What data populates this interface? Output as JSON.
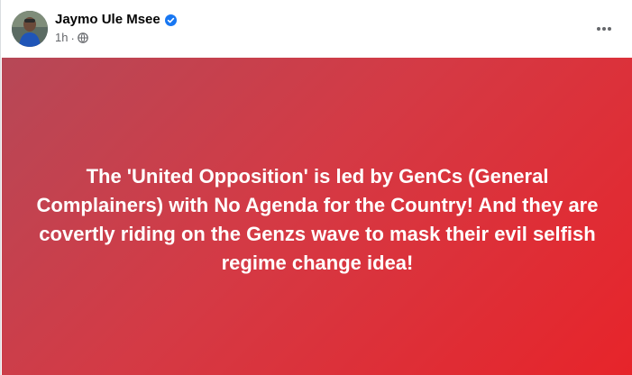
{
  "post": {
    "author_name": "Jaymo Ule Msee",
    "timestamp": "1h",
    "separator": "·",
    "icons": {
      "verified": "verified-badge-icon",
      "audience": "globe-icon",
      "more": "more-horizontal-icon",
      "avatar": "profile-photo"
    },
    "colors": {
      "verified": "#1877f2",
      "banner_start": "#b64857",
      "banner_end": "#e7242a",
      "text": "#ffffff"
    },
    "body_text": "The 'United Opposition' is led by GenCs (General Complainers) with No Agenda for the Country! And they are covertly riding on the Genzs wave to mask their evil selfish regime change idea!"
  }
}
